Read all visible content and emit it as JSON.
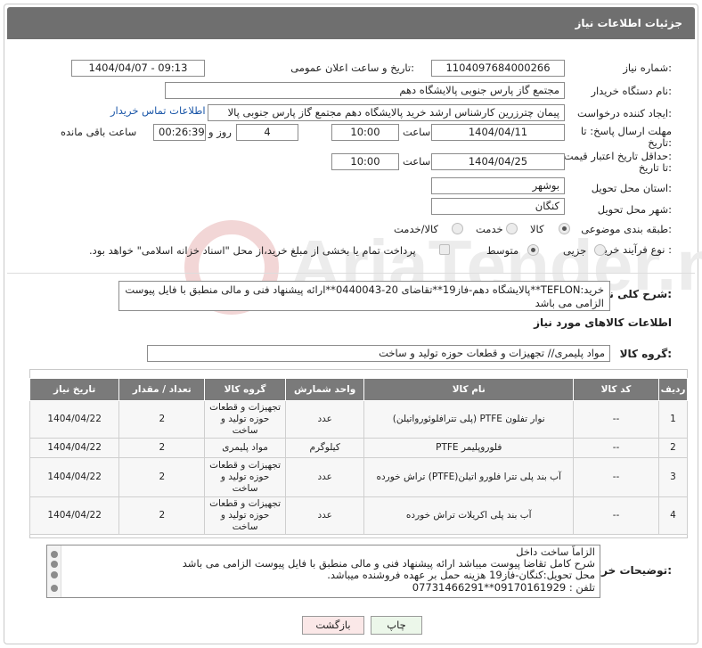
{
  "header": {
    "title": "جزئیات اطلاعات نیاز"
  },
  "fields": {
    "need_number_label": "شماره نیاز:",
    "need_number": "1104097684000266",
    "announce_label": "تاریخ و ساعت اعلان عمومی:",
    "announce_value": "1404/04/07 - 09:13",
    "buyer_org_label": "نام دستگاه خریدار:",
    "buyer_org": "مجتمع گاز پارس جنوبی  پالایشگاه دهم",
    "creator_label": "ایجاد کننده درخواست:",
    "creator": "پیمان چترزرین کارشناس ارشد خرید پالایشگاه دهم مجتمع گاز پارس جنوبی  پالا",
    "contact_link": "اطلاعات تماس خریدار",
    "deadline_label_1": "مهلت ارسال پاسخ: تا",
    "deadline_label_2": "تاریخ:",
    "deadline_date": "1404/04/11",
    "time_label": "ساعت",
    "deadline_time": "10:00",
    "days_value": "4",
    "days_label": "روز و",
    "remaining_time": "00:26:39",
    "remaining_label": "ساعت باقی مانده",
    "validity_label_1": "حداقل تاریخ اعتبار قیمت:",
    "validity_label_2": "تا تاریخ:",
    "validity_date": "1404/04/25",
    "validity_time": "10:00",
    "province_label": "استان محل تحویل:",
    "province": "بوشهر",
    "city_label": "شهر محل تحویل:",
    "city": "کنگان",
    "category_label": "طبقه بندی موضوعی:",
    "category_options": [
      "کالا",
      "خدمت",
      "کالا/خدمت"
    ],
    "category_selected": "کالا",
    "process_label": "نوع فرآیند خرید :",
    "process_options": [
      "جزیی",
      "متوسط"
    ],
    "process_selected": "متوسط",
    "payment_note": "پرداخت تمام یا بخشی از مبلغ خرید،از محل \"اسناد خزانه اسلامی\" خواهد بود."
  },
  "summary": {
    "label": "شرح کلی نیاز:",
    "text": "خرید:TEFLON**پالایشگاه دهم-فاز19**تقاضای 20-0440043**ارائه پیشنهاد فنی و مالی منطبق با فایل پیوست الزامی می باشد"
  },
  "goods": {
    "section_title": "اطلاعات کالاهای مورد نیاز",
    "group_label": "گروه کالا:",
    "group_value": "مواد پلیمری// تجهیزات و قطعات حوزه تولید و ساخت",
    "columns": [
      "ردیف",
      "کد کالا",
      "نام کالا",
      "واحد شمارش",
      "گروه کالا",
      "تعداد / مقدار",
      "تاریخ نیاز"
    ],
    "rows": [
      {
        "idx": "1",
        "code": "--",
        "name": "نوار تفلون PTFE (پلی تترافلوئورواتیلن)",
        "unit": "عدد",
        "group": "تجهیزات و قطعات حوزه تولید و ساخت",
        "qty": "2",
        "date": "1404/04/22"
      },
      {
        "idx": "2",
        "code": "--",
        "name": "فلوروپلیمر PTFE",
        "unit": "کیلوگرم",
        "group": "مواد پلیمری",
        "qty": "2",
        "date": "1404/04/22"
      },
      {
        "idx": "3",
        "code": "--",
        "name": "آب بند پلی تترا فلورو اتیلن(PTFE) تراش خورده",
        "unit": "عدد",
        "group": "تجهیزات و قطعات حوزه تولید و ساخت",
        "qty": "2",
        "date": "1404/04/22"
      },
      {
        "idx": "4",
        "code": "--",
        "name": "آب بند پلی اکریلات تراش خورده",
        "unit": "عدد",
        "group": "تجهیزات و قطعات حوزه تولید و ساخت",
        "qty": "2",
        "date": "1404/04/22"
      }
    ]
  },
  "notes": {
    "label": "توضیحات خریدار:",
    "lines": [
      "الزاماً ساخت داخل",
      "شرح کامل تقاضا پیوست میباشد ارائه پیشنهاد فنی و مالی منطبق با فایل پیوست الزامی می باشد",
      "محل تحویل:کنگان-فاز19 هزینه حمل بر عهده فروشنده میباشد.",
      "تلفن : 09170161929**07731466291"
    ]
  },
  "buttons": {
    "print": "چاپ",
    "back": "بازگشت"
  },
  "watermark": {
    "text": "AriaTender.net"
  }
}
